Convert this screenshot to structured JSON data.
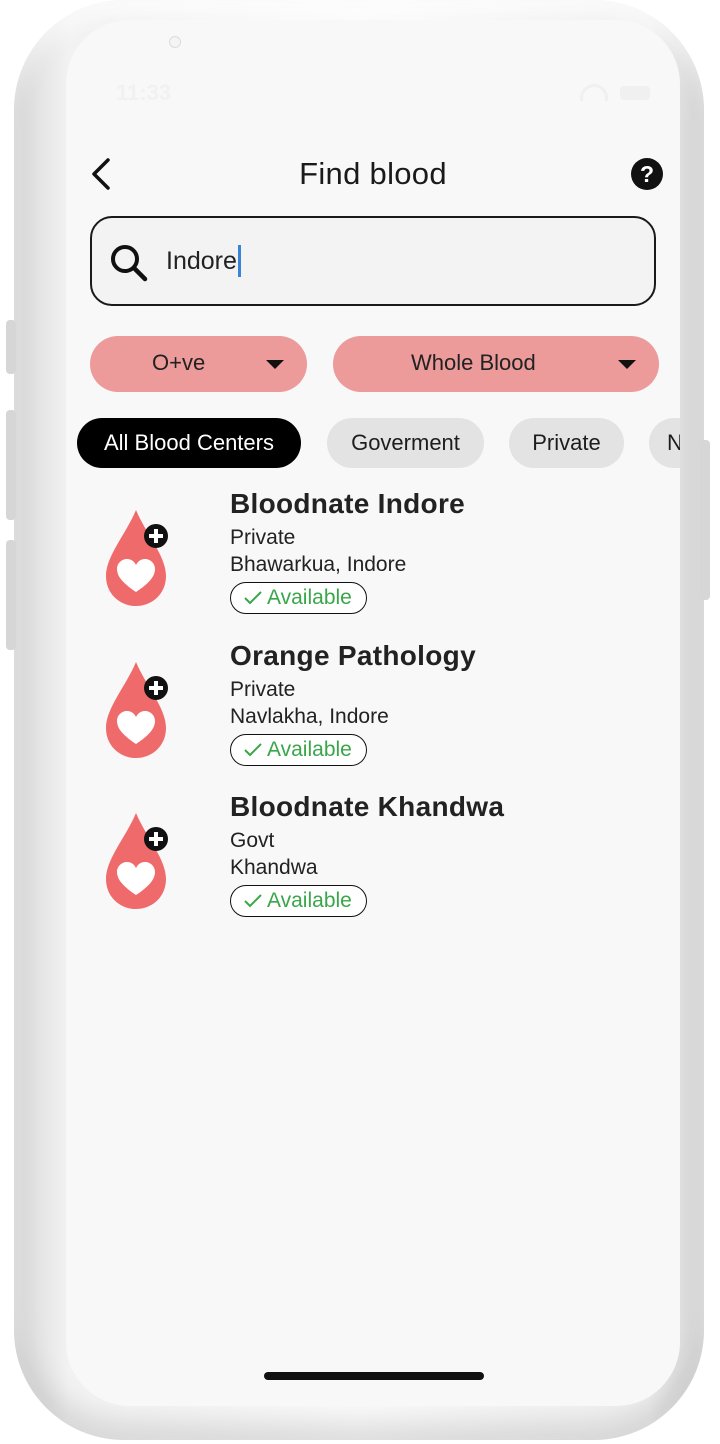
{
  "status_bar": {
    "time": "11:33"
  },
  "header": {
    "back_icon": "chevron-left-icon",
    "title": "Find blood",
    "help_icon": "question-circle-icon",
    "help_glyph": "?"
  },
  "search": {
    "icon": "search-icon",
    "value": "Indore",
    "placeholder": ""
  },
  "filters": {
    "blood_group": {
      "value": "O+ve"
    },
    "component": {
      "value": "Whole Blood"
    }
  },
  "chips": [
    {
      "label": "All Blood Centers",
      "active": true
    },
    {
      "label": "Goverment",
      "active": false
    },
    {
      "label": "Private",
      "active": false
    },
    {
      "label": "N",
      "active": false
    }
  ],
  "centers": [
    {
      "name": "Bloodnate Indore",
      "type": "Private",
      "location": "Bhawarkua, Indore",
      "status": "Available"
    },
    {
      "name": "Orange Pathology",
      "type": "Private",
      "location": "Navlakha, Indore",
      "status": "Available"
    },
    {
      "name": "Bloodnate Khandwa",
      "type": "Govt",
      "location": "Khandwa",
      "status": "Available"
    }
  ],
  "colors": {
    "accent": "#ec9a9a",
    "drop": "#ef6b6b",
    "available": "#3aa64a"
  }
}
